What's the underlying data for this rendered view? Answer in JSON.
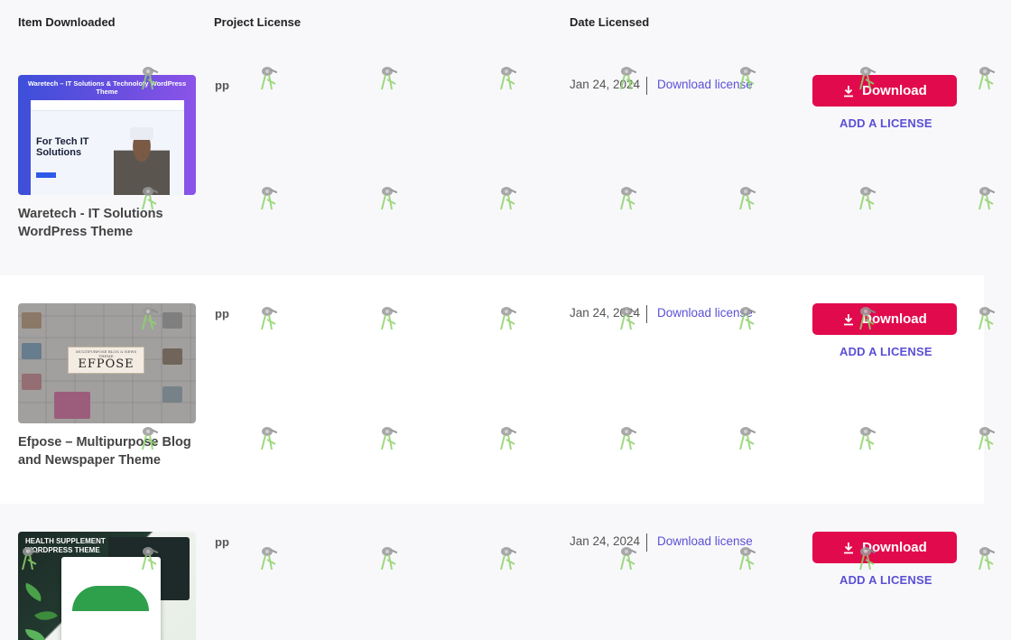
{
  "header": {
    "item_downloaded": "Item Downloaded",
    "project_license": "Project License",
    "date_licensed": "Date Licensed"
  },
  "rows": [
    {
      "title": "Waretech - IT Solutions WordPress Theme",
      "thumb_heading": "Waretech – IT Solutions & Technoloty WordPress Theme",
      "thumb_hero": "For Tech IT Solutions",
      "project": "pp",
      "date": "Jan 24, 2024",
      "download_license": "Download license",
      "download_button": "Download",
      "add_license": "ADD A LICENSE"
    },
    {
      "title": "Efpose – Multipurpose Blog and Newspaper Theme",
      "thumb_tagline": "MULTIPURPOSE BLOG & NEWS THEME",
      "thumb_logo": "EFPOSE",
      "project": "pp",
      "date": "Jan 24, 2024",
      "download_license": "Download license",
      "download_button": "Download",
      "add_license": "ADD A LICENSE"
    },
    {
      "title": "",
      "thumb_heading": "HEALTH SUPPLEMENT WORDPRESS THEME",
      "project": "pp",
      "date": "Jan 24, 2024",
      "download_license": "Download license",
      "download_button": "Download",
      "add_license": "ADD A LICENSE"
    }
  ],
  "colors": {
    "accent_button": "#e10a4d",
    "link": "#5b4fd6"
  },
  "icons": {
    "download": "download-icon",
    "watermark": "watering-can-icon"
  }
}
